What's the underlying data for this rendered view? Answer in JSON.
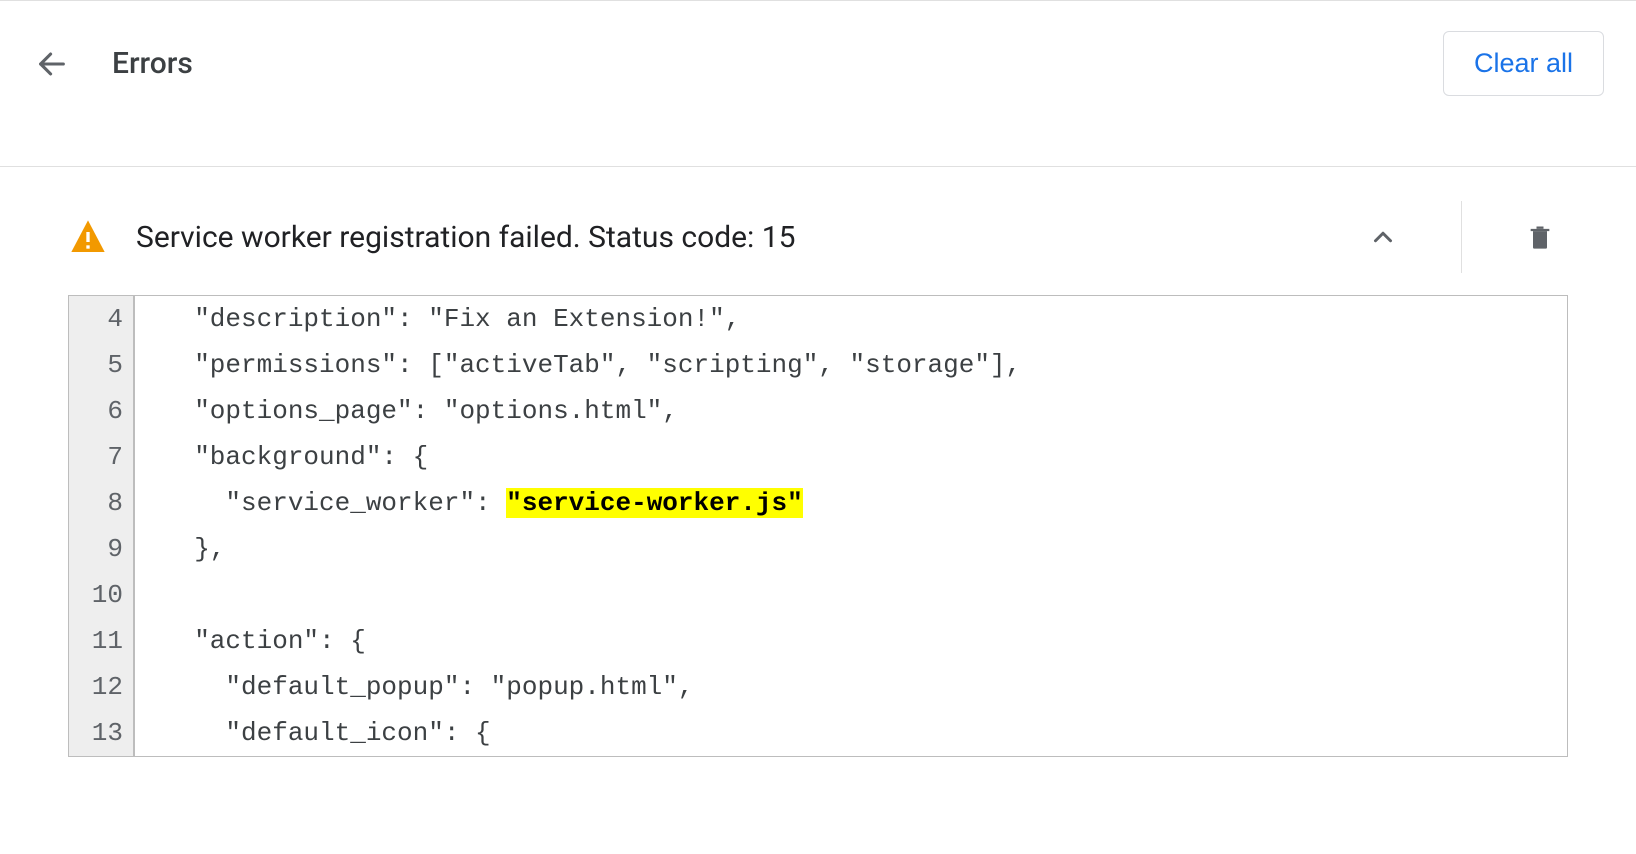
{
  "header": {
    "title": "Errors",
    "clear_all_label": "Clear all"
  },
  "error": {
    "title": "Service worker registration failed. Status code: 15",
    "code_lines": [
      {
        "n": 4,
        "pre": "  \"description\": \"Fix an Extension!\",",
        "hl": "",
        "post": ""
      },
      {
        "n": 5,
        "pre": "  \"permissions\": [\"activeTab\", \"scripting\", \"storage\"],",
        "hl": "",
        "post": ""
      },
      {
        "n": 6,
        "pre": "  \"options_page\": \"options.html\",",
        "hl": "",
        "post": ""
      },
      {
        "n": 7,
        "pre": "  \"background\": {",
        "hl": "",
        "post": ""
      },
      {
        "n": 8,
        "pre": "    \"service_worker\": ",
        "hl": "\"service-worker.js\"",
        "post": ""
      },
      {
        "n": 9,
        "pre": "  },",
        "hl": "",
        "post": ""
      },
      {
        "n": 10,
        "pre": "",
        "hl": "",
        "post": ""
      },
      {
        "n": 11,
        "pre": "  \"action\": {",
        "hl": "",
        "post": ""
      },
      {
        "n": 12,
        "pre": "    \"default_popup\": \"popup.html\",",
        "hl": "",
        "post": ""
      },
      {
        "n": 13,
        "pre": "    \"default_icon\": {",
        "hl": "",
        "post": ""
      }
    ]
  }
}
